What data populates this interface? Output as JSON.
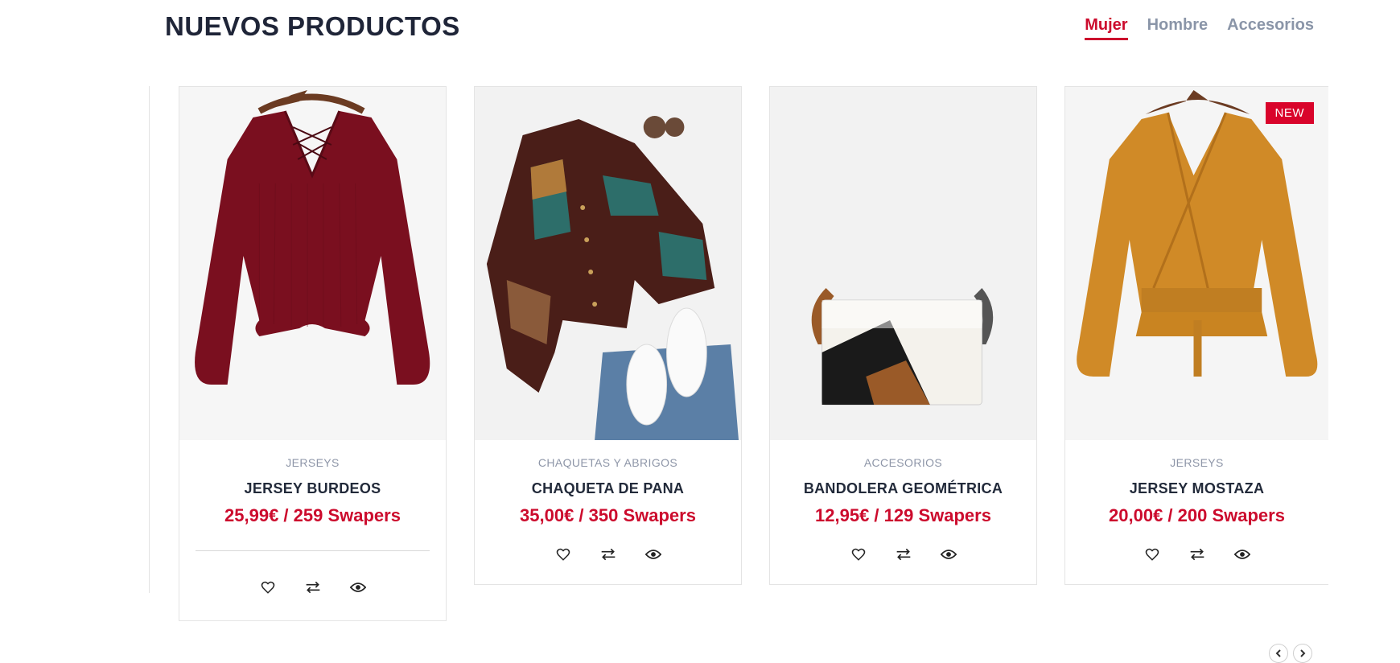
{
  "section": {
    "title": "NUEVOS PRODUCTOS"
  },
  "tabs": [
    {
      "label": "Mujer",
      "active": true
    },
    {
      "label": "Hombre",
      "active": false
    },
    {
      "label": "Accesorios",
      "active": false
    }
  ],
  "products": [
    {
      "category": "JERSEYS",
      "name": "JERSEY BURDEOS",
      "price": "25,99€ / 259 Swapers",
      "image": "burgundy-sweater"
    },
    {
      "category": "CHAQUETAS Y ABRIGOS",
      "name": "CHAQUETA DE PANA",
      "price": "35,00€ / 350 Swapers",
      "image": "corduroy-jacket-flatlay"
    },
    {
      "category": "ACCESORIOS",
      "name": "BANDOLERA GEOMÉTRICA",
      "price": "12,95€ / 129 Swapers",
      "image": "geometric-crossbody-bag"
    },
    {
      "category": "JERSEYS",
      "name": "JERSEY MOSTAZA",
      "price": "20,00€ / 200 Swapers",
      "image": "mustard-wrap-sweater",
      "badge": "NEW"
    }
  ],
  "icons": {
    "wishlist": "heart-icon",
    "compare": "arrows-exchange-icon",
    "quickview": "eye-icon",
    "prev": "chevron-left-icon",
    "next": "chevron-right-icon"
  },
  "colors": {
    "accent": "#cc0b2d",
    "badge": "#d9042b",
    "title": "#1f2538",
    "muted": "#8a95a8"
  }
}
